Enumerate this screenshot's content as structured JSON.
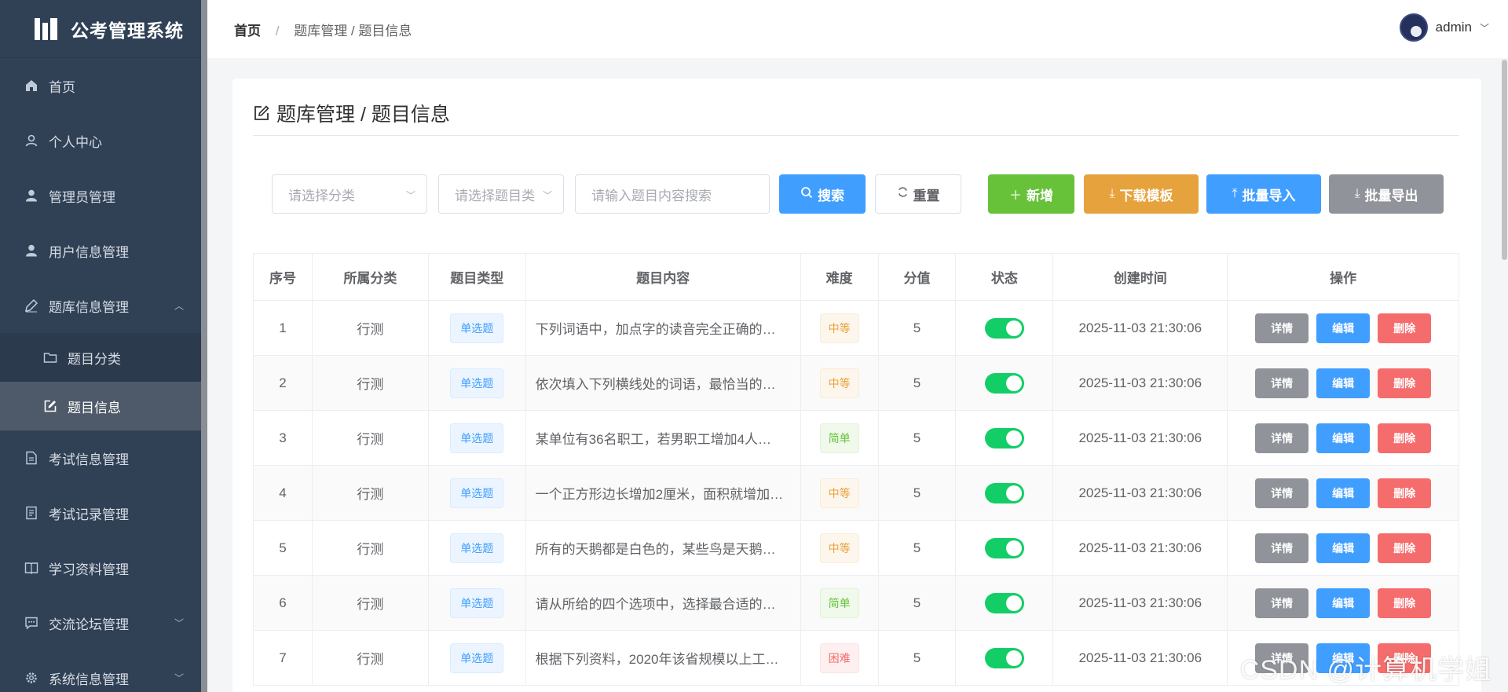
{
  "app": {
    "title": "公考管理系统"
  },
  "sidebar": {
    "items": [
      {
        "label": "首页",
        "icon": "home-icon"
      },
      {
        "label": "个人中心",
        "icon": "user-outline-icon"
      },
      {
        "label": "管理员管理",
        "icon": "user-icon"
      },
      {
        "label": "用户信息管理",
        "icon": "user-icon"
      },
      {
        "label": "题库信息管理",
        "icon": "pen-icon",
        "expanded": true
      },
      {
        "label": "题目分类",
        "icon": "folder-icon",
        "sub": true
      },
      {
        "label": "题目信息",
        "icon": "edit-icon",
        "sub": true,
        "active": true
      },
      {
        "label": "考试信息管理",
        "icon": "document-icon"
      },
      {
        "label": "考试记录管理",
        "icon": "list-icon"
      },
      {
        "label": "学习资料管理",
        "icon": "book-icon"
      },
      {
        "label": "交流论坛管理",
        "icon": "chat-icon",
        "collapsed": true
      },
      {
        "label": "系统信息管理",
        "icon": "gear-icon",
        "collapsed": true
      }
    ]
  },
  "header": {
    "breadcrumb_home": "首页",
    "breadcrumb_sep": "/",
    "breadcrumb_rest": "题库管理 / 题目信息",
    "username": "admin"
  },
  "page": {
    "title": "题库管理 / 题目信息"
  },
  "toolbar": {
    "category_placeholder": "请选择分类",
    "type_placeholder": "请选择题目类",
    "search_placeholder": "请输入题目内容搜索",
    "search_label": "搜索",
    "reset_label": "重置",
    "add_label": "新增",
    "template_label": "下载模板",
    "import_label": "批量导入",
    "export_label": "批量导出"
  },
  "table": {
    "headers": [
      "序号",
      "所属分类",
      "题目类型",
      "题目内容",
      "难度",
      "分值",
      "状态",
      "创建时间",
      "操作"
    ],
    "actions": {
      "detail": "详情",
      "edit": "编辑",
      "delete": "删除"
    },
    "rows": [
      {
        "no": "1",
        "category": "行测",
        "type": "单选题",
        "content": "下列词语中，加点字的读音完全正确的…",
        "difficulty": "中等",
        "level": "mid",
        "score": "5",
        "enabled": true,
        "created": "2025-11-03 21:30:06"
      },
      {
        "no": "2",
        "category": "行测",
        "type": "单选题",
        "content": "依次填入下列横线处的词语，最恰当的…",
        "difficulty": "中等",
        "level": "mid",
        "score": "5",
        "enabled": true,
        "created": "2025-11-03 21:30:06"
      },
      {
        "no": "3",
        "category": "行测",
        "type": "单选题",
        "content": "某单位有36名职工，若男职工增加4人…",
        "difficulty": "简单",
        "level": "easy",
        "score": "5",
        "enabled": true,
        "created": "2025-11-03 21:30:06"
      },
      {
        "no": "4",
        "category": "行测",
        "type": "单选题",
        "content": "一个正方形边长增加2厘米，面积就增加…",
        "difficulty": "中等",
        "level": "mid",
        "score": "5",
        "enabled": true,
        "created": "2025-11-03 21:30:06"
      },
      {
        "no": "5",
        "category": "行测",
        "type": "单选题",
        "content": "所有的天鹅都是白色的，某些鸟是天鹅…",
        "difficulty": "中等",
        "level": "mid",
        "score": "5",
        "enabled": true,
        "created": "2025-11-03 21:30:06"
      },
      {
        "no": "6",
        "category": "行测",
        "type": "单选题",
        "content": "请从所给的四个选项中，选择最合适的…",
        "difficulty": "简单",
        "level": "easy",
        "score": "5",
        "enabled": true,
        "created": "2025-11-03 21:30:06"
      },
      {
        "no": "7",
        "category": "行测",
        "type": "单选题",
        "content": "根据下列资料，2020年该省规模以上工…",
        "difficulty": "困难",
        "level": "hard",
        "score": "5",
        "enabled": true,
        "created": "2025-11-03 21:30:06"
      }
    ]
  },
  "watermark": "CSDN @计算机学姐",
  "colors": {
    "sidebar": "#304156",
    "primary": "#409eff",
    "success": "#67c23a",
    "warning": "#e6a23c",
    "danger": "#f56c6c",
    "info": "#909399",
    "switch_on": "#13ce66"
  }
}
